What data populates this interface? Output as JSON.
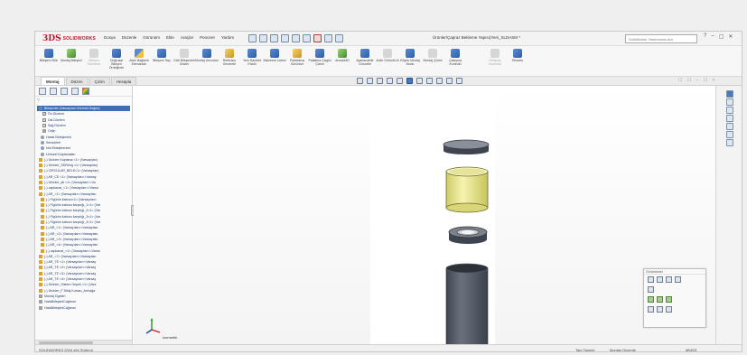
{
  "app": {
    "logo_brand": "3DS",
    "logo_text": "SOLIDWORKS",
    "document_title": "Ürünler/Çapraz Bekleme Yapısı(Yeni_SLDASM *",
    "search_placeholder": "SolidWorks Yardımında Ara",
    "menu": [
      "Dosya",
      "Düzenle",
      "Görünüm",
      "Ekle",
      "Araçlar",
      "Pencere",
      "Yardım"
    ],
    "window_controls": [
      "?",
      "–",
      "▢",
      "✕"
    ]
  },
  "ribbon": {
    "buttons": [
      {
        "label": "Bileşeni Ekle",
        "icon": "insert-components-icon",
        "color": "b",
        "enabled": true
      },
      {
        "label": "Montaj Bileşeni",
        "icon": "mate-icon",
        "color": "g",
        "enabled": true
      },
      {
        "label": "Bileşen Önizleme",
        "icon": "component-preview-icon",
        "color": "grey",
        "enabled": false
      },
      {
        "label": "Doğrusal Bileşen Örneğinde",
        "icon": "linear-pattern-icon",
        "color": "b",
        "enabled": true
      },
      {
        "label": "Akıllı Bağlantı Elemanları",
        "icon": "smart-fasteners-icon",
        "color": "mix",
        "enabled": true
      },
      {
        "label": "Bileşeni Taşı",
        "icon": "move-component-icon",
        "color": "b",
        "enabled": true
      },
      {
        "label": "Gizli Bileşenleri Göster",
        "icon": "show-hidden-icon",
        "color": "grey",
        "enabled": true
      },
      {
        "label": "Montaj Unsurları",
        "icon": "assembly-features-icon",
        "color": "b",
        "enabled": true
      },
      {
        "label": "Referans Geometri",
        "icon": "reference-geometry-icon",
        "color": "y",
        "enabled": true
      },
      {
        "label": "Yeni Hareket Etüdü",
        "icon": "motion-study-icon",
        "color": "b",
        "enabled": true
      },
      {
        "label": "Malzeme Listesi",
        "icon": "bom-icon",
        "color": "b",
        "enabled": true
      },
      {
        "label": "Patlatılmış Görünüm",
        "icon": "exploded-view-icon",
        "color": "y",
        "enabled": true
      },
      {
        "label": "Patlatma Çizgisi Çizimi",
        "icon": "explode-line-icon",
        "color": "b",
        "enabled": true
      },
      {
        "label": "Anında3D",
        "icon": "instant3d-icon",
        "color": "g",
        "enabled": true
      },
      {
        "label": "Ayarlanabilir Güncelle",
        "icon": "update-icon",
        "color": "b",
        "enabled": true
      },
      {
        "label": "Anlık Görüntü Al",
        "icon": "snapshot-icon",
        "color": "grey",
        "enabled": true
      },
      {
        "label": "Büyük Montaj Modu",
        "icon": "large-assembly-icon",
        "color": "b",
        "enabled": true
      },
      {
        "label": "Montaj Çizimi",
        "icon": "assembly-drawing-icon",
        "color": "grey",
        "enabled": true
      },
      {
        "label": "Çakışma Kontrolü",
        "icon": "interference-icon",
        "color": "b",
        "enabled": true
      },
      {
        "label": "Gelişmiş Komutlar",
        "icon": "advanced-icon",
        "color": "grey",
        "enabled": false
      },
      {
        "label": "Rhodes",
        "icon": "rhodes-icon",
        "color": "b",
        "enabled": true
      }
    ]
  },
  "tabs": [
    {
      "label": "Montaj",
      "active": true
    },
    {
      "label": "Düzen",
      "active": false
    },
    {
      "label": "Çizim",
      "active": false
    },
    {
      "label": "Hesapla",
      "active": false
    }
  ],
  "view_corner_text": "☐ ☐ –  ☐ ×",
  "tree": {
    "filter_text": "▽",
    "nodes": [
      {
        "text": "Bileşenler (Varsayılan Görüntü Değeri)",
        "icon": "blue",
        "indent": 0,
        "root": true
      },
      {
        "text": "Ön Düzlem",
        "icon": "plane",
        "indent": 6
      },
      {
        "text": "Üst Düzlem",
        "icon": "plane",
        "indent": 6
      },
      {
        "text": "Sağ Düzlem",
        "icon": "plane",
        "indent": 6
      },
      {
        "text": "Orijin",
        "icon": "mate",
        "indent": 6
      },
      {
        "text": "Hatalı Birleşimleri",
        "icon": "gear",
        "indent": 4
      },
      {
        "text": "Sensörleri",
        "icon": "gear",
        "indent": 4
      },
      {
        "text": "Not Ekleştirenleri",
        "icon": "gear",
        "indent": 4
      },
      {
        "text": "Ürünsel Kaplamaları",
        "icon": "gear",
        "indent": 4
      },
      {
        "text": "(-) Ürünler Kaplama <1> (Varsayılan)",
        "icon": "part",
        "indent": 2
      },
      {
        "text": "(-) Ürünler_SDReng <1> (Varsayılan)",
        "icon": "part",
        "indent": 2
      },
      {
        "text": "(-) CIRCULAR_BELK<1> (Varsayılan)",
        "icon": "part",
        "indent": 2
      },
      {
        "text": "(-) AR_CE <1> (Varsayılan<<Varsay",
        "icon": "part",
        "indent": 2
      },
      {
        "text": "(-) Ürünler_alt <1> (Varsayılan<<Va",
        "icon": "part",
        "indent": 2
      },
      {
        "text": "(-) capkanat_<1> (Varsayılan<<Varsa",
        "icon": "part",
        "indent": 2
      },
      {
        "text": "(-) AR_<1> (Varsayılan<<Varsayılan",
        "icon": "part",
        "indent": 2
      },
      {
        "text": "(-) Figürün kaburu<1> (Varsayılan<",
        "icon": "part",
        "indent": 4
      },
      {
        "text": "(-) Figürün kaburu karşılığı_1<1> (Var",
        "icon": "part",
        "indent": 4
      },
      {
        "text": "(-) Figürün kaburu karşılığı_2<1> (Var",
        "icon": "part",
        "indent": 4
      },
      {
        "text": "(-) Figürün kaburu karşılığı_3<1> (Var",
        "icon": "part",
        "indent": 4
      },
      {
        "text": "(-) Figürün kaburu karşılığı_4<1> (Var",
        "icon": "part",
        "indent": 4
      },
      {
        "text": "(-) AR_<1> (Varsayılan<<Varsayılan",
        "icon": "part",
        "indent": 4
      },
      {
        "text": "(-) AR_<2> (Varsayılan<<Varsayılan",
        "icon": "part",
        "indent": 4
      },
      {
        "text": "(-) AR_<3> (Varsayılan<<Varsayılan",
        "icon": "part",
        "indent": 4
      },
      {
        "text": "(-) AR_<4> (Varsayılan<<Varsayılan",
        "icon": "part",
        "indent": 4
      },
      {
        "text": "(-) capkanat_<1> (Varsayılan<<Varsa",
        "icon": "part",
        "indent": 4
      },
      {
        "text": "(-) AR_<7> (Varsayılan<<Varsayılan",
        "icon": "part",
        "indent": 2
      },
      {
        "text": "(-) AR_TE <1> (Varsayılan<<Varsay",
        "icon": "part",
        "indent": 2
      },
      {
        "text": "(-) AR_TE <2> (Varsayılan<<Varsay",
        "icon": "part",
        "indent": 2
      },
      {
        "text": "(-) AR_TE <3> (Varsayılan<<Varsay",
        "icon": "part",
        "indent": 2
      },
      {
        "text": "(-) AR_TE <4> (Varsayılan<<Varsay",
        "icon": "part",
        "indent": 2
      },
      {
        "text": "(-) Ürünler_Sistem Gepek <1> (Vars",
        "icon": "part",
        "indent": 2
      },
      {
        "text": "(-) Ürünler_F Dikiş Kutusu_Armağa",
        "icon": "part",
        "indent": 2
      },
      {
        "text": "Montaj Ögeleri",
        "icon": "mate",
        "indent": 2
      },
      {
        "text": "HataBirleşimlCağtmal",
        "icon": "mate",
        "indent": 2
      },
      {
        "text": "HataBirleşimlCağtmal",
        "icon": "mate",
        "indent": 2
      }
    ]
  },
  "graphics": {
    "triad_label": "İzometrik",
    "parts": [
      {
        "name": "top-cap",
        "color": "#5c6370"
      },
      {
        "name": "yellow-sleeve",
        "color": "#f1ef9c"
      },
      {
        "name": "ring-washer",
        "color": "#6d7480"
      },
      {
        "name": "long-tube",
        "color": "#5c6270"
      }
    ]
  },
  "palette": {
    "title": "Görünümler"
  },
  "status": {
    "left": "SOLIDWORKS 2016 x64 Sürümü",
    "state": "Tam Tanımlı",
    "mode": "Montajı Düzenle",
    "units": "MMGS"
  }
}
